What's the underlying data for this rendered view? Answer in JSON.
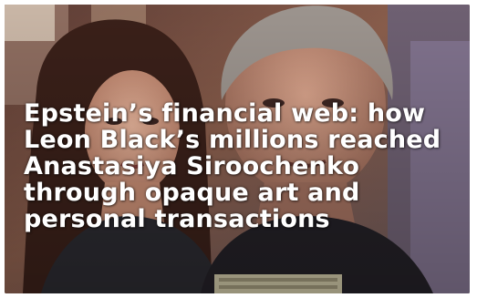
{
  "article": {
    "headline": "Epstein’s financial web: how Leon Black’s millions reached Anastasiya Siroochenko through opaque art and personal transactions"
  },
  "colors": {
    "headline_text": "#ffffff",
    "frame_background": "#ffffff"
  }
}
